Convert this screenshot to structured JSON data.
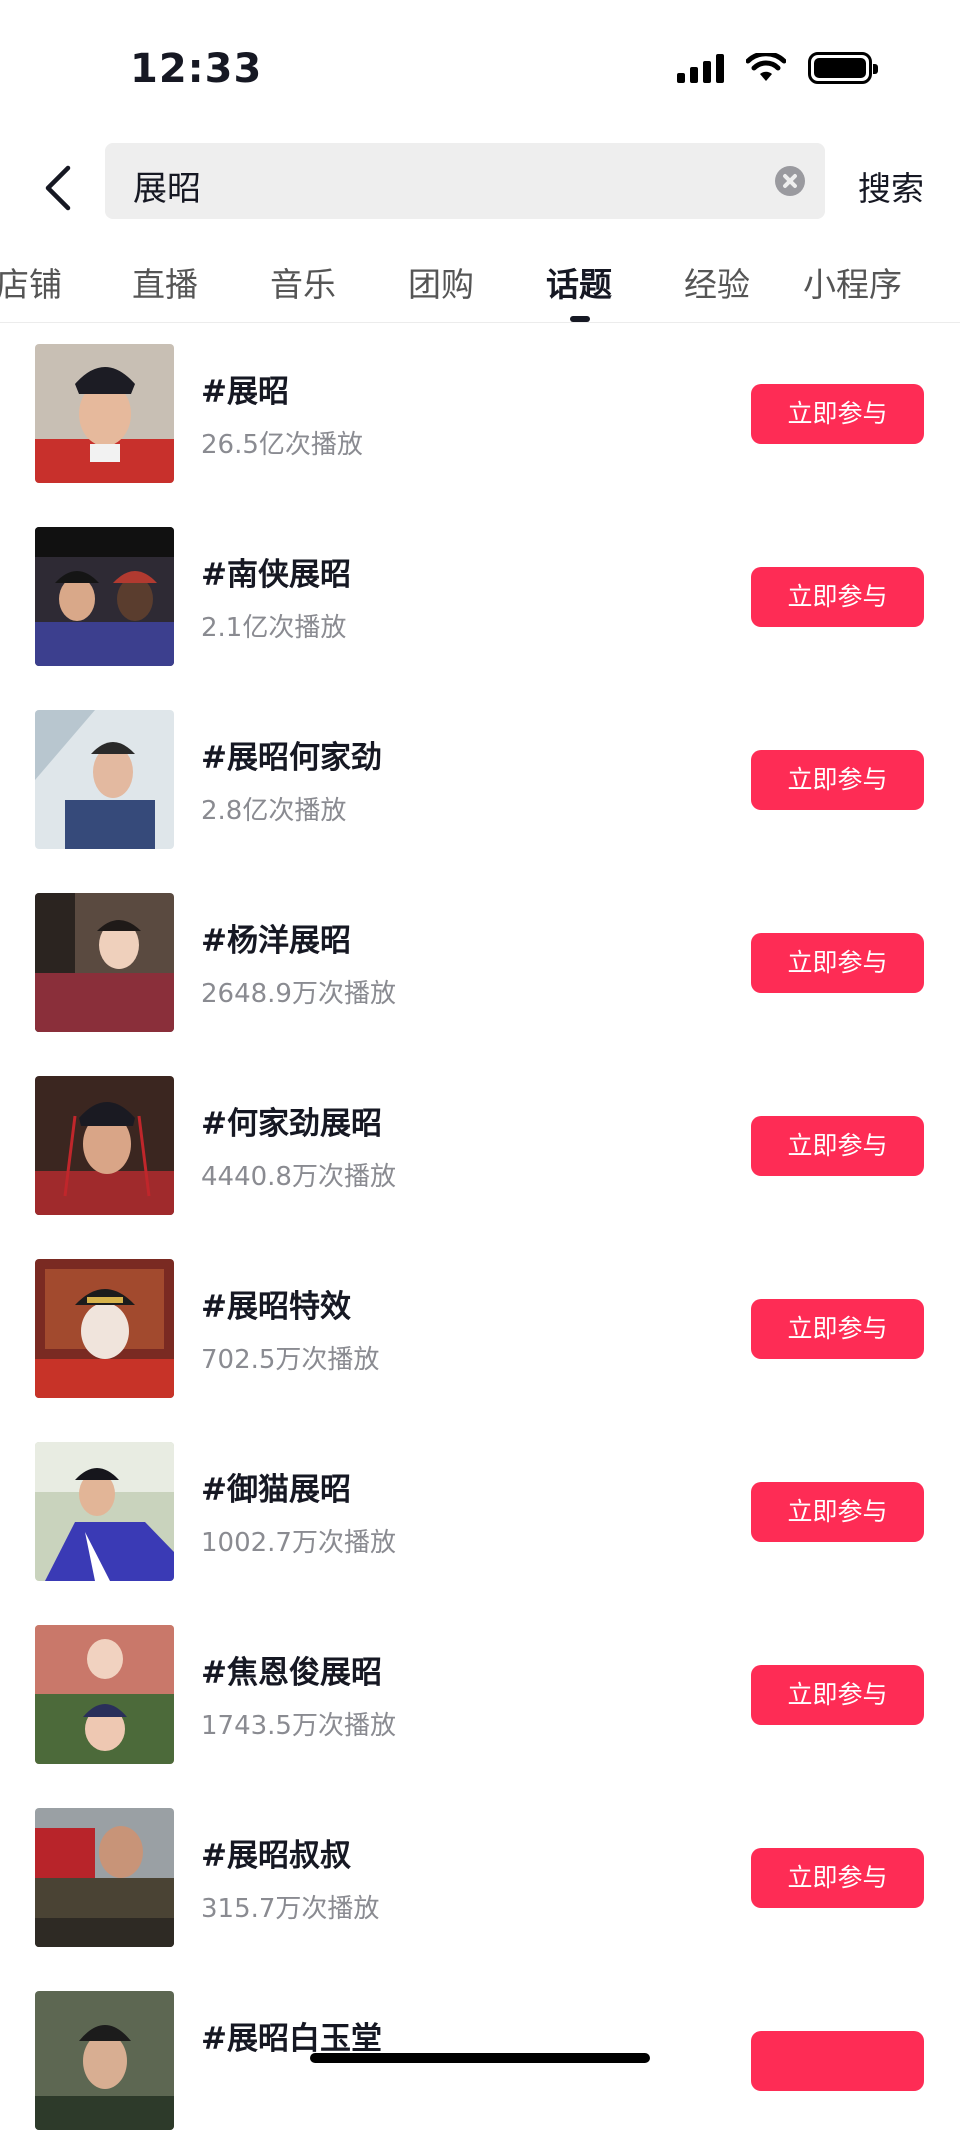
{
  "status_bar": {
    "time": "12:33"
  },
  "search": {
    "query": "展昭",
    "button_label": "搜索"
  },
  "tabs": [
    {
      "label": "店铺",
      "active": false
    },
    {
      "label": "直播",
      "active": false
    },
    {
      "label": "音乐",
      "active": false
    },
    {
      "label": "团购",
      "active": false
    },
    {
      "label": "话题",
      "active": true
    },
    {
      "label": "经验",
      "active": false
    },
    {
      "label": "小程序",
      "active": false
    }
  ],
  "topics": [
    {
      "title": "#展昭",
      "plays": "26.5亿次播放",
      "button": "立即参与"
    },
    {
      "title": "#南侠展昭",
      "plays": "2.1亿次播放",
      "button": "立即参与"
    },
    {
      "title": "#展昭何家劲",
      "plays": "2.8亿次播放",
      "button": "立即参与"
    },
    {
      "title": "#杨洋展昭",
      "plays": "2648.9万次播放",
      "button": "立即参与"
    },
    {
      "title": "#何家劲展昭",
      "plays": "4440.8万次播放",
      "button": "立即参与"
    },
    {
      "title": "#展昭特效",
      "plays": "702.5万次播放",
      "button": "立即参与"
    },
    {
      "title": "#御猫展昭",
      "plays": "1002.7万次播放",
      "button": "立即参与"
    },
    {
      "title": "#焦恩俊展昭",
      "plays": "1743.5万次播放",
      "button": "立即参与"
    },
    {
      "title": "#展昭叔叔",
      "plays": "315.7万次播放",
      "button": "立即参与"
    },
    {
      "title": "#展昭白玉堂",
      "plays": "",
      "button": ""
    }
  ],
  "colors": {
    "accent": "#fe2c55",
    "text": "#161823",
    "subtext": "#8a8b91"
  }
}
